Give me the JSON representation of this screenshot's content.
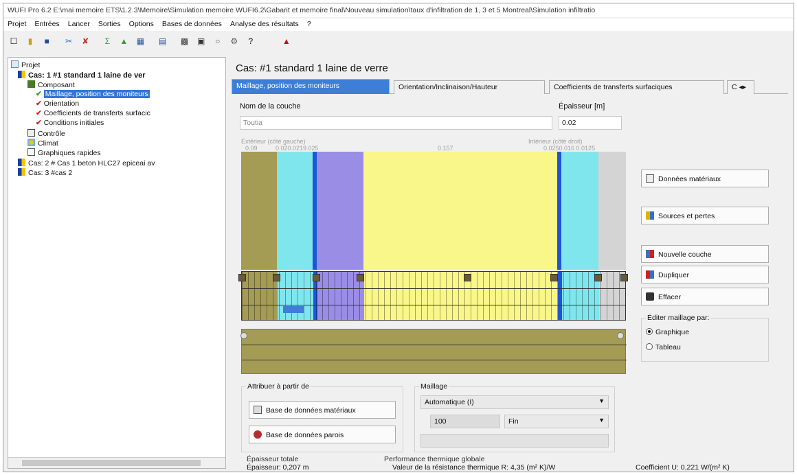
{
  "window": {
    "title": "WUFI Pro 6.2   E:\\mai memoire ETS\\1.2.3\\Memoire\\Simulation memoire WUFI6.2\\Gabarit et memoire final\\Nouveau simulation\\taux d'infiltration de 1, 3 et 5 Montreal\\Simulation infiltratio"
  },
  "menu": [
    "Projet",
    "Entrées",
    "Lancer",
    "Sorties",
    "Options",
    "Bases de données",
    "Analyse des résultats",
    "?"
  ],
  "toolbar_icons": [
    "new-icon",
    "open-icon",
    "save-icon",
    "cut-icon",
    "copy-icon",
    "calc-icon",
    "run-icon",
    "results-icon",
    "chart-icon",
    "table-icon",
    "layers-icon",
    "circle-icon",
    "settings-icon",
    "help-icon",
    "wufi-icon"
  ],
  "tree": {
    "root": "Projet",
    "case1": "Cas: 1 #1 standard  1 laine de ver",
    "component": "Composant",
    "items": [
      "Maillage, position des moniteurs",
      "Orientation",
      "Coefficients de transferts surfacic",
      "Conditions initiales"
    ],
    "control": "Contrôle",
    "climate": "Climat",
    "quick_graphs": "Graphiques rapides",
    "case2": "Cas: 2 # Cas 1 beton HLC27 epiceai av",
    "case3": "Cas: 3 #cas 2"
  },
  "main": {
    "case_title": "Cas:  #1 standard  1 laine de verre",
    "tabs": [
      "Maillage, position des moniteurs",
      "Orientation/Inclinaison/Hauteur",
      "Coefficients de transferts surfaciques",
      "C"
    ],
    "layer_name_label": "Nom de la couche",
    "layer_name_value": "Toutia",
    "thickness_label": "Épaisseur [m]",
    "thickness_value": "0.02",
    "size_labels": [
      "Extérieur (côté gauche)",
      "0.09",
      "0.020.0219.025",
      "0.157",
      "Intérieur (côté droit)",
      "0.0250.016  0.0125"
    ],
    "buttons": {
      "materials": "Données matériaux",
      "sources": "Sources et pertes",
      "new_layer": "Nouvelle couche",
      "duplicate": "Dupliquer",
      "delete": "Effacer"
    },
    "edit_mesh": {
      "title": "Éditer maillage par:",
      "options": [
        "Graphique",
        "Tableau"
      ],
      "selected": "Graphique"
    },
    "assign": {
      "title": "Attribuer à partir de",
      "material_db": "Base de données matériaux",
      "wall_db": "Base de données parois"
    },
    "mesh": {
      "title": "Maillage",
      "mode": "Automatique (I)",
      "count": "100",
      "fineness": "Fin"
    },
    "totals": {
      "thickness_title": "Épaisseur totale",
      "thickness": "Épaisseur: 0,207 m",
      "performance_title": "Performance thermique globale",
      "resistance": "Valeur de la résistance thermique R: 4,35 (m² K)/W",
      "u_value": "Coefficient U: 0,221 W/(m² K)"
    }
  },
  "colors": {
    "olive": "#a49b55",
    "cyan": "#7fe6ee",
    "blue_line": "#1f55d6",
    "purple": "#9a8de6",
    "yellow": "#faf78a",
    "grey": "#d4d4d4",
    "tab_active": "#3d7fd6"
  }
}
